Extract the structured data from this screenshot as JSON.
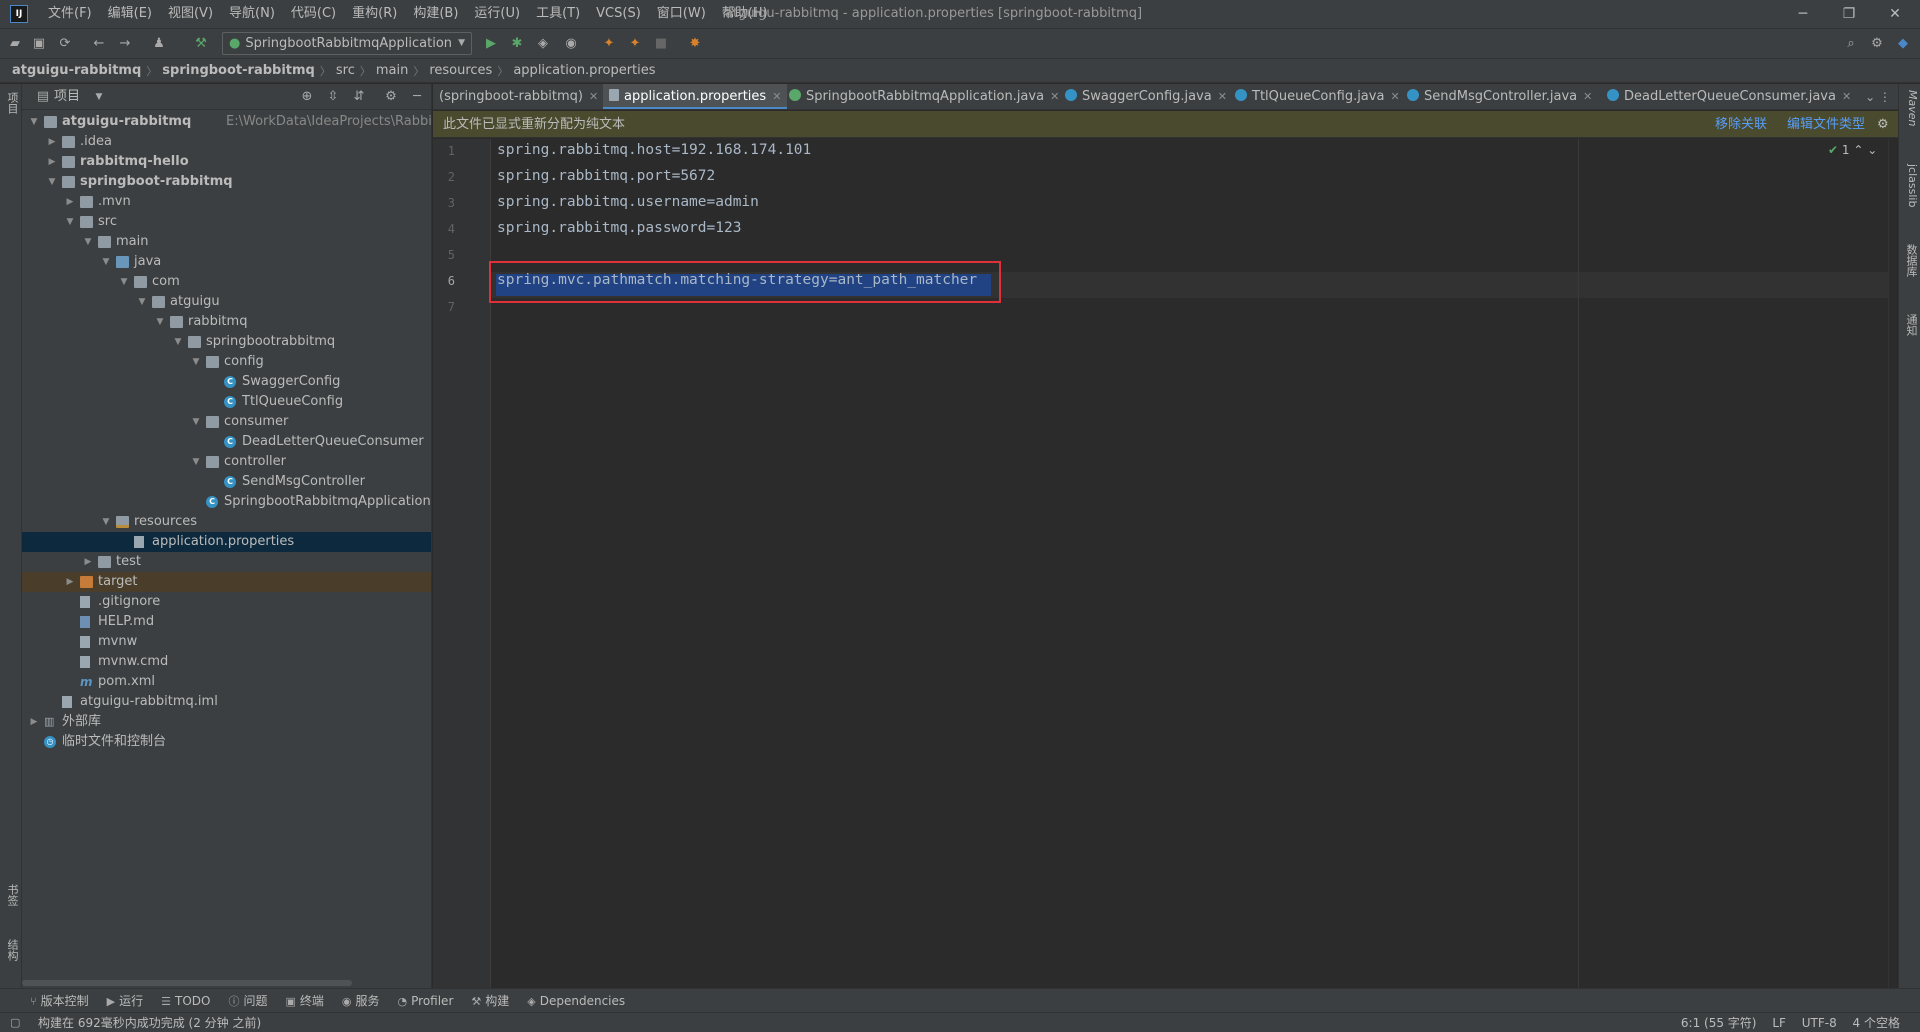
{
  "app": {
    "logo": "IJ",
    "window_title": "atguigu-rabbitmq - application.properties [springboot-rabbitmq]",
    "menu": [
      "文件(F)",
      "编辑(E)",
      "视图(V)",
      "导航(N)",
      "代码(C)",
      "重构(R)",
      "构建(B)",
      "运行(U)",
      "工具(T)",
      "VCS(S)",
      "窗口(W)",
      "帮助(H)"
    ]
  },
  "toolbar": {
    "run_config": "SpringbootRabbitmqApplication"
  },
  "breadcrumb": [
    "atguigu-rabbitmq",
    "springboot-rabbitmq",
    "src",
    "main",
    "resources",
    "application.properties"
  ],
  "left_strip": {
    "top_tab": "项目",
    "bottom_tabs": [
      "书签",
      "结构"
    ]
  },
  "right_strip": {
    "tabs": [
      "Maven",
      "jclasslib",
      "数据库",
      "通知"
    ]
  },
  "project": {
    "title": "项目",
    "tree": [
      {
        "label": "atguigu-rabbitmq",
        "path": "E:\\WorkData\\IdeaProjects\\RabbitMQ\\at",
        "bold": true,
        "indent": 0,
        "arrow": "open",
        "icon": "folder"
      },
      {
        "label": ".idea",
        "indent": 1,
        "arrow": "closed",
        "icon": "folder"
      },
      {
        "label": "rabbitmq-hello",
        "bold": true,
        "indent": 1,
        "arrow": "closed",
        "icon": "folder"
      },
      {
        "label": "springboot-rabbitmq",
        "bold": true,
        "indent": 1,
        "arrow": "open",
        "icon": "folder"
      },
      {
        "label": ".mvn",
        "indent": 2,
        "arrow": "closed",
        "icon": "folder"
      },
      {
        "label": "src",
        "indent": 2,
        "arrow": "open",
        "icon": "folder"
      },
      {
        "label": "main",
        "indent": 3,
        "arrow": "open",
        "icon": "folder"
      },
      {
        "label": "java",
        "indent": 4,
        "arrow": "open",
        "icon": "folder-blue"
      },
      {
        "label": "com",
        "indent": 5,
        "arrow": "open",
        "icon": "folder"
      },
      {
        "label": "atguigu",
        "indent": 6,
        "arrow": "open",
        "icon": "folder"
      },
      {
        "label": "rabbitmq",
        "indent": 7,
        "arrow": "open",
        "icon": "folder"
      },
      {
        "label": "springbootrabbitmq",
        "indent": 8,
        "arrow": "open",
        "icon": "folder"
      },
      {
        "label": "config",
        "indent": 9,
        "arrow": "open",
        "icon": "folder"
      },
      {
        "label": "SwaggerConfig",
        "indent": 10,
        "arrow": "none",
        "icon": "class"
      },
      {
        "label": "TtlQueueConfig",
        "indent": 10,
        "arrow": "none",
        "icon": "class"
      },
      {
        "label": "consumer",
        "indent": 9,
        "arrow": "open",
        "icon": "folder"
      },
      {
        "label": "DeadLetterQueueConsumer",
        "indent": 10,
        "arrow": "none",
        "icon": "class"
      },
      {
        "label": "controller",
        "indent": 9,
        "arrow": "open",
        "icon": "folder"
      },
      {
        "label": "SendMsgController",
        "indent": 10,
        "arrow": "none",
        "icon": "class"
      },
      {
        "label": "SpringbootRabbitmqApplication",
        "indent": 9,
        "arrow": "none",
        "icon": "class-run"
      },
      {
        "label": "resources",
        "indent": 4,
        "arrow": "open",
        "icon": "folder-res"
      },
      {
        "label": "application.properties",
        "indent": 5,
        "arrow": "none",
        "icon": "file",
        "selected": true
      },
      {
        "label": "test",
        "indent": 3,
        "arrow": "closed",
        "icon": "folder"
      },
      {
        "label": "target",
        "indent": 2,
        "arrow": "closed",
        "icon": "folder-orange",
        "excluded": true
      },
      {
        "label": ".gitignore",
        "indent": 2,
        "arrow": "none",
        "icon": "file"
      },
      {
        "label": "HELP.md",
        "indent": 2,
        "arrow": "none",
        "icon": "file-md"
      },
      {
        "label": "mvnw",
        "indent": 2,
        "arrow": "none",
        "icon": "file"
      },
      {
        "label": "mvnw.cmd",
        "indent": 2,
        "arrow": "none",
        "icon": "file"
      },
      {
        "label": "pom.xml",
        "indent": 2,
        "arrow": "none",
        "icon": "pom"
      },
      {
        "label": "atguigu-rabbitmq.iml",
        "indent": 1,
        "arrow": "none",
        "icon": "file"
      },
      {
        "label": "外部库",
        "indent": 0,
        "arrow": "closed",
        "icon": "lib"
      },
      {
        "label": "临时文件和控制台",
        "indent": 0,
        "arrow": "none",
        "icon": "scratch"
      }
    ]
  },
  "editor": {
    "tabs": [
      {
        "label": "(springboot-rabbitmq)",
        "icon": "none"
      },
      {
        "label": "application.properties",
        "icon": "file",
        "active": true
      },
      {
        "label": "SpringbootRabbitmqApplication.java",
        "icon": "sb"
      },
      {
        "label": "SwaggerConfig.java",
        "icon": "class"
      },
      {
        "label": "TtlQueueConfig.java",
        "icon": "class"
      },
      {
        "label": "SendMsgController.java",
        "icon": "class"
      },
      {
        "label": "DeadLetterQueueConsumer.java",
        "icon": "class"
      }
    ],
    "notice": "此文件已显式重新分配为纯文本",
    "notice_actions": [
      "移除关联",
      "编辑文件类型"
    ],
    "inspection_count": "1",
    "lines": [
      {
        "num": "1",
        "text": "spring.rabbitmq.host=192.168.174.101"
      },
      {
        "num": "2",
        "text": "spring.rabbitmq.port=5672"
      },
      {
        "num": "3",
        "text": "spring.rabbitmq.username=admin"
      },
      {
        "num": "4",
        "text": "spring.rabbitmq.password=123"
      },
      {
        "num": "5",
        "text": ""
      },
      {
        "num": "6",
        "text": "spring.mvc.pathmatch.matching-strategy=ant_path_matcher",
        "selected": true
      },
      {
        "num": "7",
        "text": ""
      }
    ]
  },
  "bottom_tabs": [
    {
      "icon": "vcs-icon",
      "label": "版本控制"
    },
    {
      "icon": "run-icon",
      "label": "运行"
    },
    {
      "icon": "todo-icon",
      "label": "TODO"
    },
    {
      "icon": "problems-icon",
      "label": "问题"
    },
    {
      "icon": "terminal-icon",
      "label": "终端"
    },
    {
      "icon": "services-icon",
      "label": "服务"
    },
    {
      "icon": "profiler-icon",
      "label": "Profiler"
    },
    {
      "icon": "build-icon",
      "label": "构建"
    },
    {
      "icon": "dependencies-icon",
      "label": "Dependencies"
    }
  ],
  "status": {
    "message": "构建在 692毫秒内成功完成 (2 分钟 之前)",
    "position": "6:1 (55 字符)",
    "line_sep": "LF",
    "encoding": "UTF-8",
    "indent": "4 个空格"
  }
}
